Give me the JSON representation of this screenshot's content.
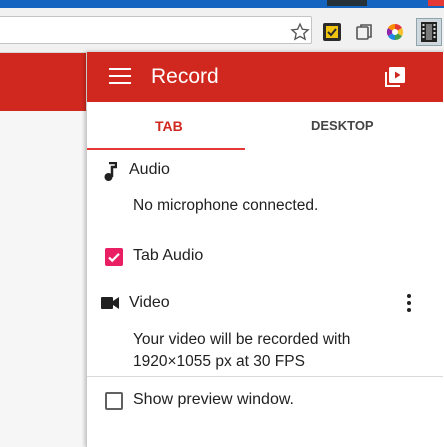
{
  "popup": {
    "title": "Record",
    "tabs": [
      "TAB",
      "DESKTOP"
    ],
    "active_tab": "TAB",
    "audio": {
      "label": "Audio",
      "status": "No microphone connected.",
      "tab_audio_label": "Tab Audio",
      "tab_audio_checked": true
    },
    "video": {
      "label": "Video",
      "info_line1": "Your video will be recorded with",
      "info_line2": "1920×1055 px at 30 FPS",
      "preview_label": "Show preview window.",
      "preview_checked": false
    }
  },
  "colors": {
    "header": "#d0281e",
    "accent": "#e91e63",
    "chrome_blue": "#1565c0"
  },
  "toolbar": {
    "icons": [
      "star-icon",
      "extension-icon",
      "window-icon",
      "color-circle-icon",
      "film-icon"
    ]
  }
}
